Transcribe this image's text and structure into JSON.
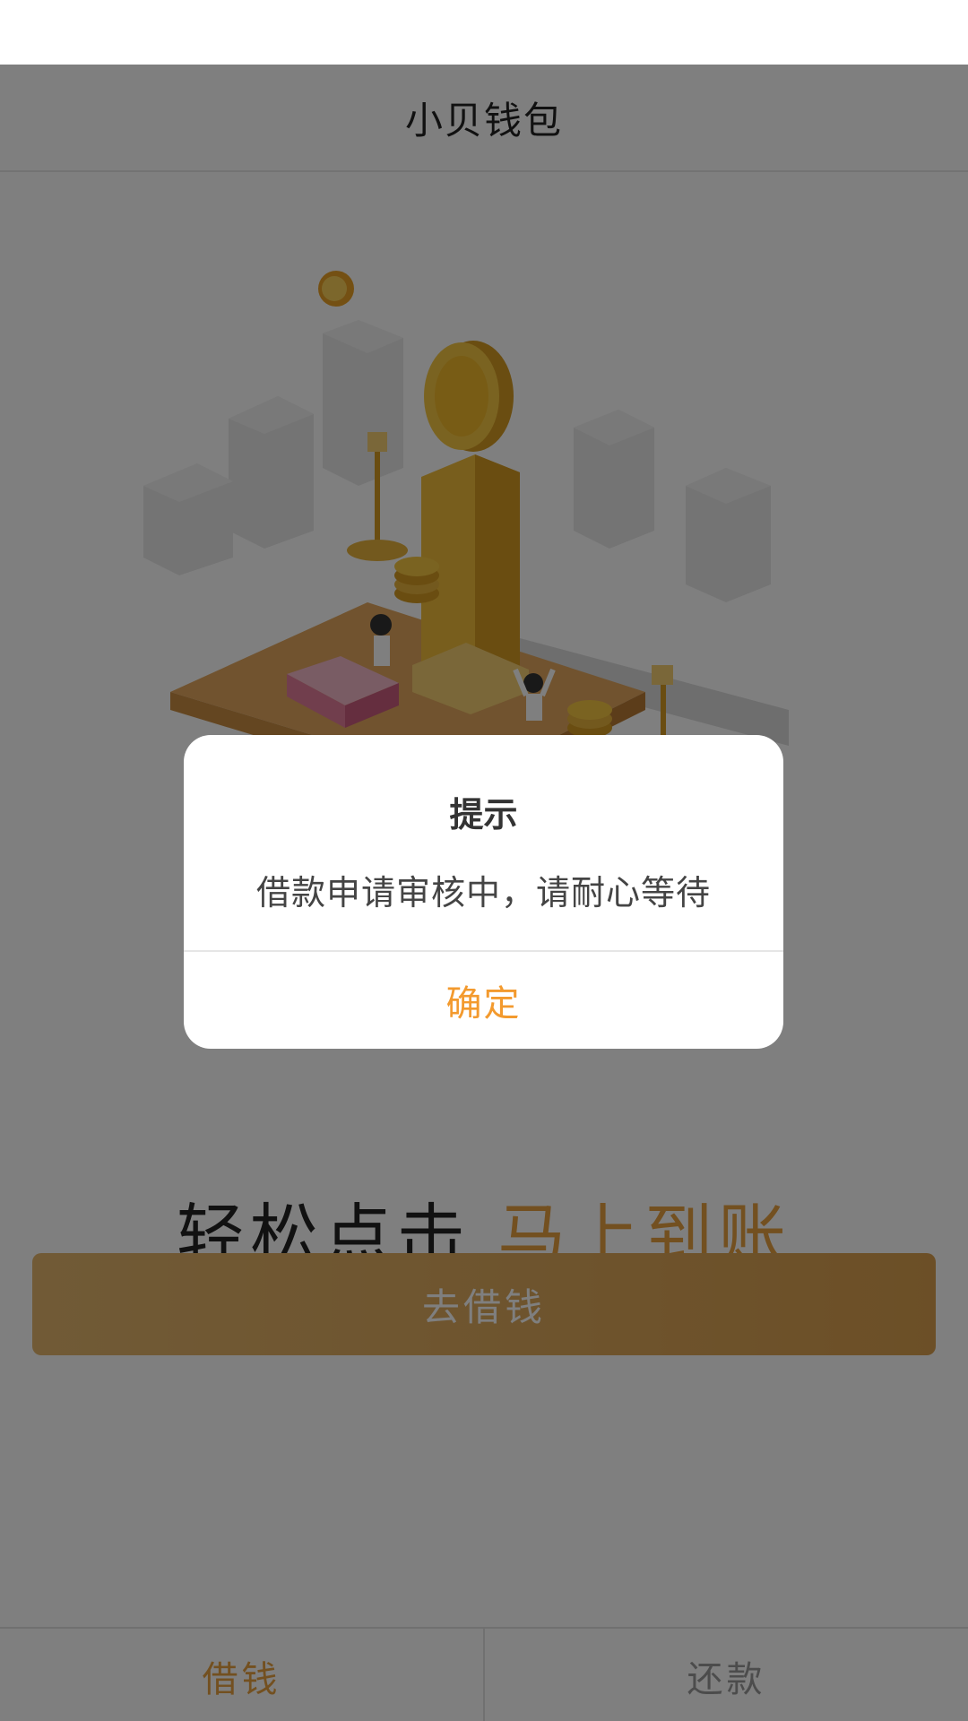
{
  "header": {
    "title": "小贝钱包"
  },
  "hero": {
    "slogan_part1": "轻松点击",
    "slogan_part2": "马上到账",
    "borrow_button_label": "去借钱"
  },
  "tabs": [
    {
      "label": "借钱",
      "active": true
    },
    {
      "label": "还款",
      "active": false
    }
  ],
  "dialog": {
    "title": "提示",
    "message": "借款申请审核中，请耐心等待",
    "confirm_label": "确定"
  },
  "colors": {
    "accent": "#e7a040",
    "confirm_text": "#f39a2e",
    "overlay": "rgba(0,0,0,0.5)"
  }
}
